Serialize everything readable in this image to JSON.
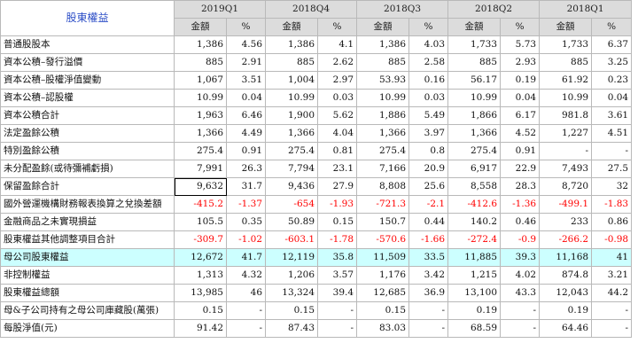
{
  "table": {
    "title": "股東權益",
    "periods": [
      "2019Q1",
      "2018Q4",
      "2018Q3",
      "2018Q2",
      "2018Q1"
    ],
    "sub_headers": [
      "金額",
      "%"
    ],
    "rows": [
      {
        "label": "普通股股本",
        "cells": [
          "1,386",
          "4.56",
          "1,386",
          "4.1",
          "1,386",
          "4.03",
          "1,733",
          "5.73",
          "1,733",
          "6.37"
        ]
      },
      {
        "label": "資本公積–發行溢價",
        "cells": [
          "885",
          "2.91",
          "885",
          "2.62",
          "885",
          "2.58",
          "885",
          "2.93",
          "885",
          "3.25"
        ]
      },
      {
        "label": "資本公積–股權淨值變動",
        "cells": [
          "1,067",
          "3.51",
          "1,004",
          "2.97",
          "53.93",
          "0.16",
          "56.17",
          "0.19",
          "61.92",
          "0.23"
        ]
      },
      {
        "label": "資本公積–認股權",
        "cells": [
          "10.99",
          "0.04",
          "10.99",
          "0.03",
          "10.99",
          "0.03",
          "10.99",
          "0.04",
          "10.99",
          "0.04"
        ]
      },
      {
        "label": "資本公積合計",
        "cells": [
          "1,963",
          "6.46",
          "1,900",
          "5.62",
          "1,886",
          "5.49",
          "1,866",
          "6.17",
          "981.8",
          "3.61"
        ]
      },
      {
        "label": "法定盈餘公積",
        "cells": [
          "1,366",
          "4.49",
          "1,366",
          "4.04",
          "1,366",
          "3.97",
          "1,366",
          "4.52",
          "1,227",
          "4.51"
        ]
      },
      {
        "label": "特別盈餘公積",
        "cells": [
          "275.4",
          "0.91",
          "275.4",
          "0.81",
          "275.4",
          "0.8",
          "275.4",
          "0.91",
          "-",
          "-"
        ]
      },
      {
        "label": "未分配盈餘(或待彌補虧損)",
        "cells": [
          "7,991",
          "26.3",
          "7,794",
          "23.1",
          "7,166",
          "20.9",
          "6,917",
          "22.9",
          "7,493",
          "27.5"
        ]
      },
      {
        "label": "保留盈餘合計",
        "cells": [
          "9,632",
          "31.7",
          "9,436",
          "27.9",
          "8,808",
          "25.6",
          "8,558",
          "28.3",
          "8,720",
          "32"
        ]
      },
      {
        "label": "國外營運機構財務報表換算之兌換差額",
        "cells": [
          "-415.2",
          "-1.37",
          "-654",
          "-1.93",
          "-721.3",
          "-2.1",
          "-412.6",
          "-1.36",
          "-499.1",
          "-1.83"
        ]
      },
      {
        "label": "金融商品之未實現損益",
        "cells": [
          "105.5",
          "0.35",
          "50.89",
          "0.15",
          "150.7",
          "0.44",
          "140.2",
          "0.46",
          "233",
          "0.86"
        ]
      },
      {
        "label": "股東權益其他調整項目合計",
        "cells": [
          "-309.7",
          "-1.02",
          "-603.1",
          "-1.78",
          "-570.6",
          "-1.66",
          "-272.4",
          "-0.9",
          "-266.2",
          "-0.98"
        ]
      },
      {
        "label": "母公司股東權益",
        "cells": [
          "12,672",
          "41.7",
          "12,119",
          "35.8",
          "11,509",
          "33.5",
          "11,885",
          "39.3",
          "11,168",
          "41"
        ]
      },
      {
        "label": "非控制權益",
        "cells": [
          "1,313",
          "4.32",
          "1,206",
          "3.57",
          "1,176",
          "3.42",
          "1,215",
          "4.02",
          "874.8",
          "3.21"
        ]
      },
      {
        "label": "股東權益總額",
        "cells": [
          "13,985",
          "46",
          "13,324",
          "39.4",
          "12,685",
          "36.9",
          "13,100",
          "43.3",
          "12,043",
          "44.2"
        ]
      },
      {
        "label": "母&子公司持有之母公司庫藏股(萬張)",
        "cells": [
          "0.15",
          "-",
          "0.15",
          "-",
          "0.15",
          "-",
          "0.19",
          "-",
          "0.19",
          "-"
        ]
      },
      {
        "label": "每股淨值(元)",
        "cells": [
          "91.42",
          "-",
          "87.43",
          "-",
          "83.03",
          "-",
          "68.59",
          "-",
          "64.46",
          "-"
        ]
      }
    ]
  }
}
